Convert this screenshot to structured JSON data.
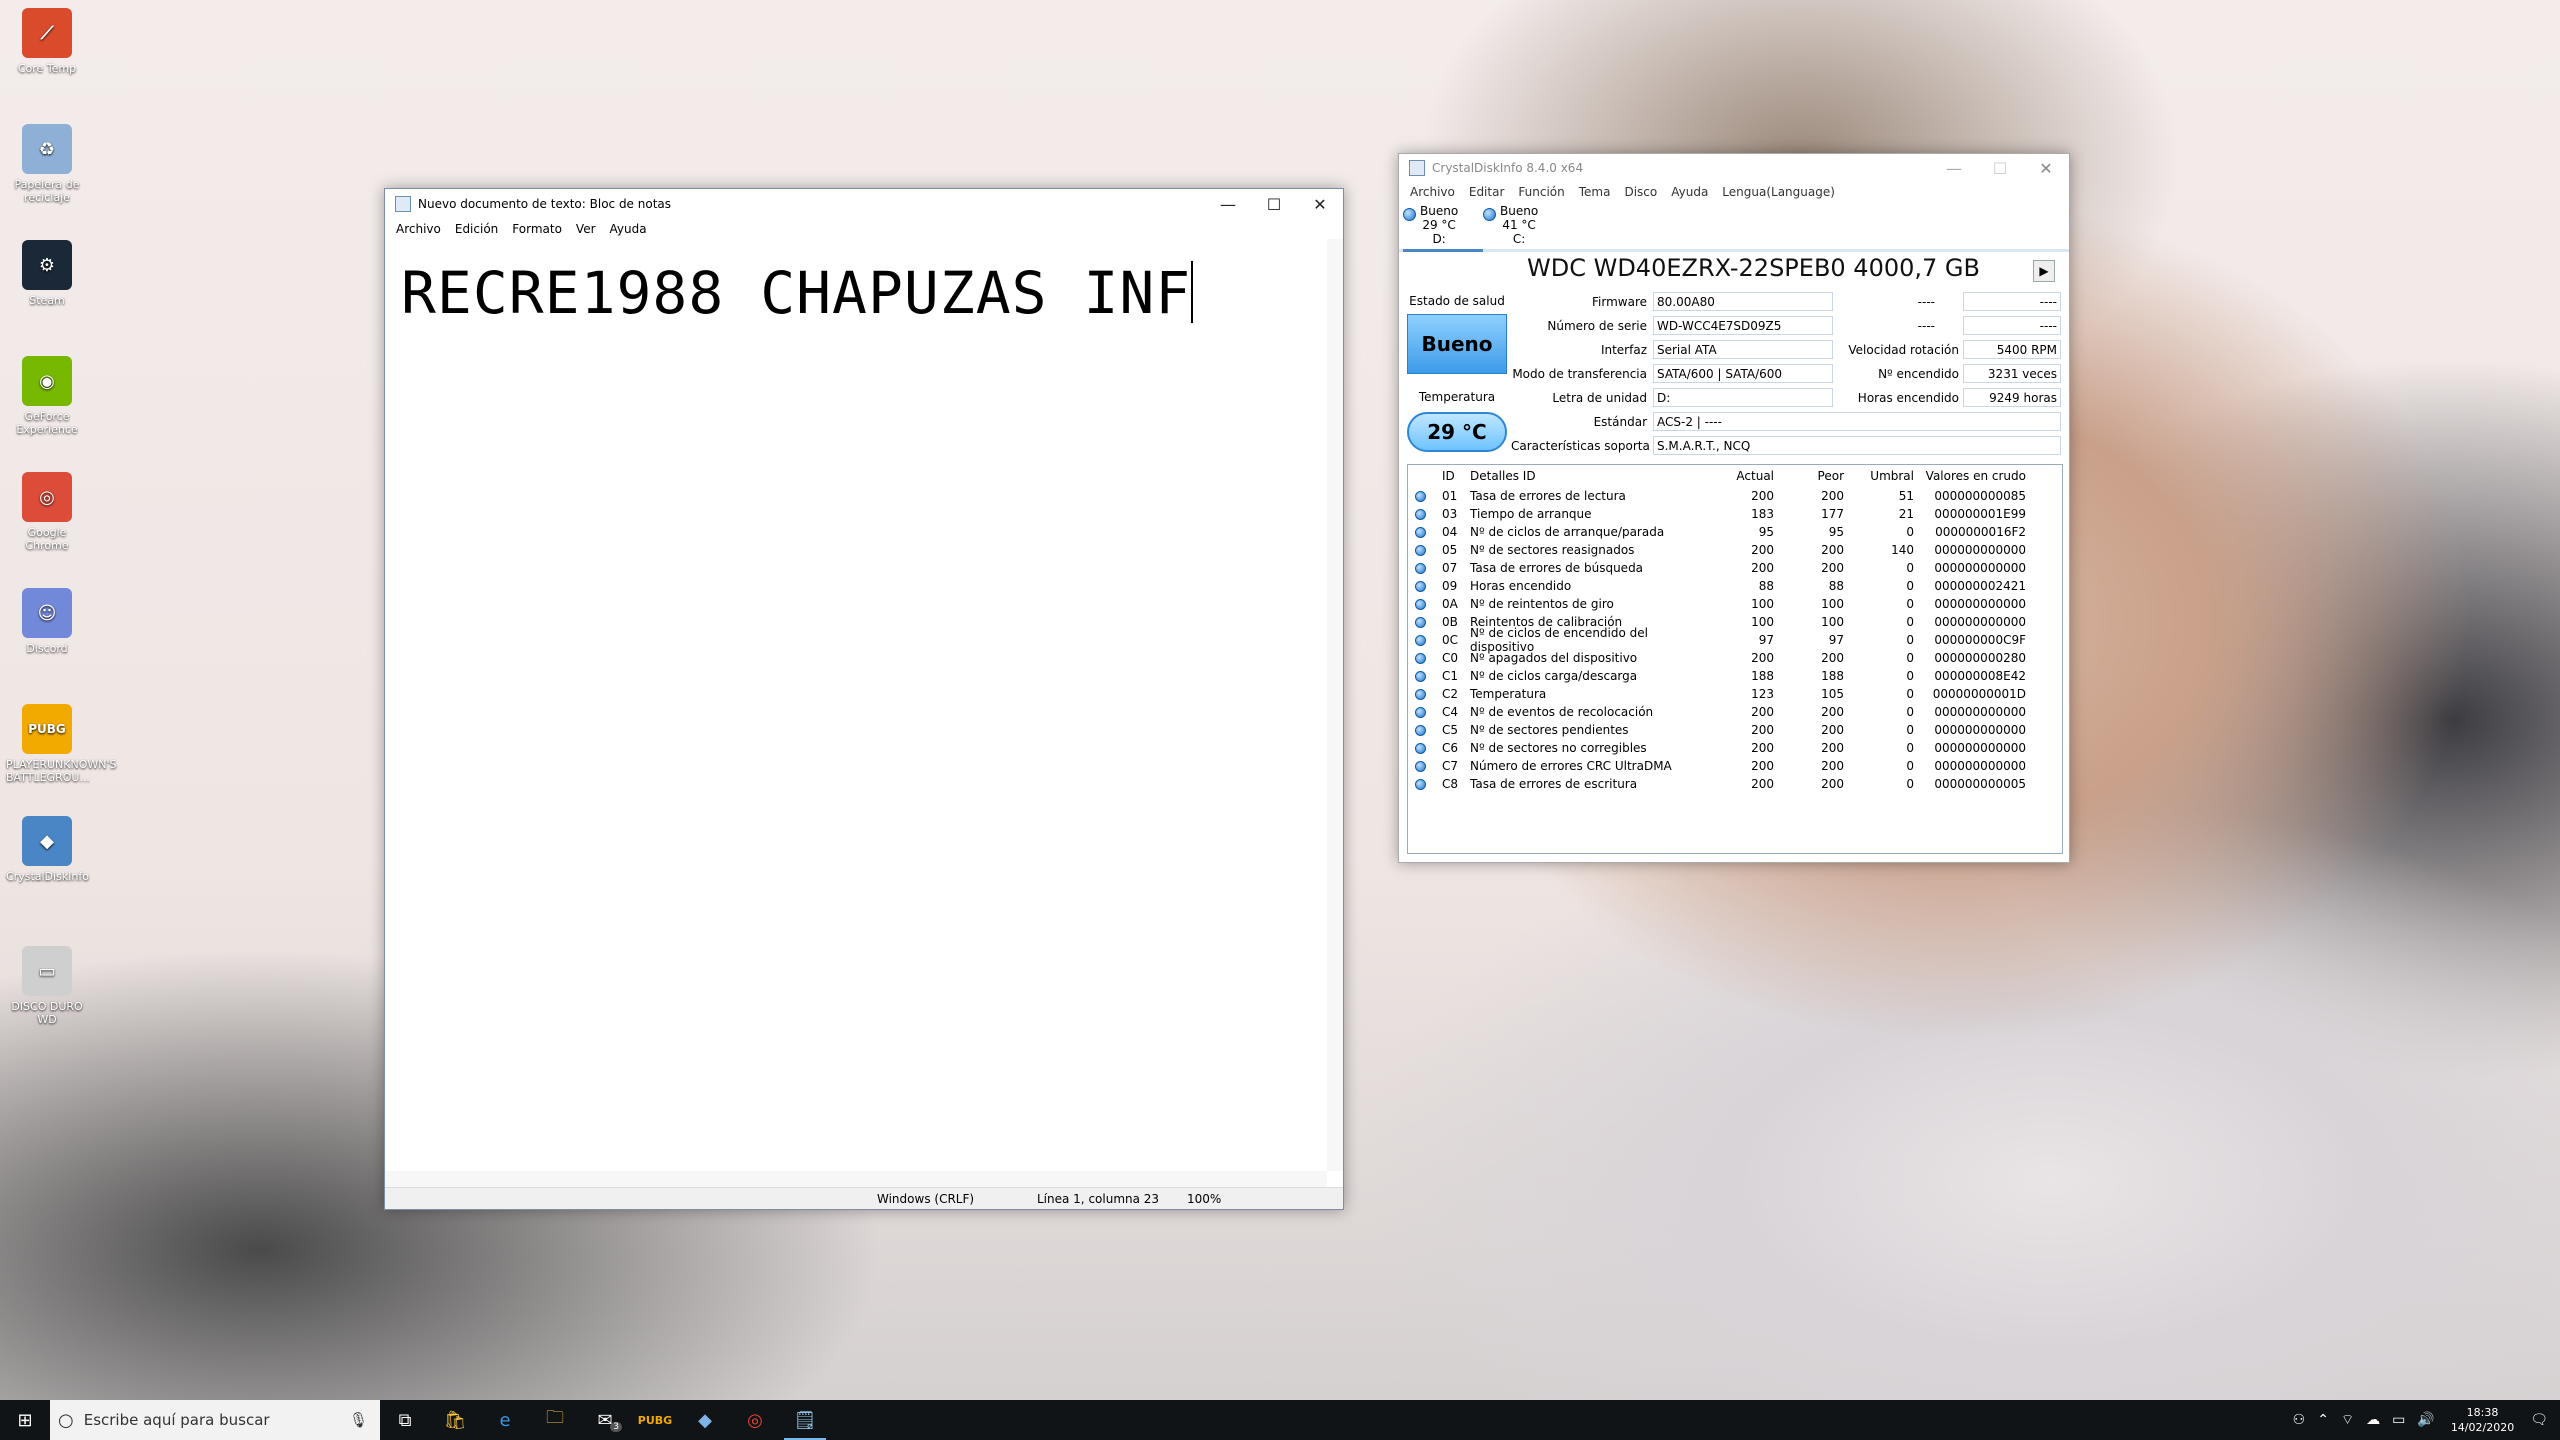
{
  "desktop": {
    "icons": [
      {
        "label": "Core Temp",
        "icon": "thermometer-app-icon",
        "glyph": "⟋",
        "color": "#d94b2b"
      },
      {
        "label": "Papelera de reciclaje",
        "icon": "recycle-bin-icon",
        "glyph": "♻",
        "color": "#8fb0d6"
      },
      {
        "label": "Steam",
        "icon": "steam-icon",
        "glyph": "⚙",
        "color": "#1b2838"
      },
      {
        "label": "GeForce Experience",
        "icon": "geforce-icon",
        "glyph": "◉",
        "color": "#76b900"
      },
      {
        "label": "Google Chrome",
        "icon": "chrome-icon",
        "glyph": "◎",
        "color": "#dd4b39"
      },
      {
        "label": "Discord",
        "icon": "discord-icon",
        "glyph": "☺",
        "color": "#7289da"
      },
      {
        "label": "PLAYERUNKNOWN'S BATTLEGROU...",
        "icon": "pubg-icon",
        "glyph": "PUBG",
        "color": "#f2a900"
      },
      {
        "label": "CrystalDiskInfo",
        "icon": "crystaldiskinfo-icon",
        "glyph": "◆",
        "color": "#4a86c5"
      },
      {
        "label": "DISCO DURO WD",
        "icon": "hard-drive-icon",
        "glyph": "▭",
        "color": "#cfcfcf"
      }
    ]
  },
  "notepad": {
    "title": "Nuevo documento de texto: Bloc de notas",
    "menu": [
      "Archivo",
      "Edición",
      "Formato",
      "Ver",
      "Ayuda"
    ],
    "content": "RECRE1988 CHAPUZAS INF",
    "status": {
      "encoding": "Windows (CRLF)",
      "position": "Línea 1, columna 23",
      "zoom": "100%"
    }
  },
  "cdi": {
    "title": "CrystalDiskInfo 8.4.0 x64",
    "menu": [
      "Archivo",
      "Editar",
      "Función",
      "Tema",
      "Disco",
      "Ayuda",
      "Lengua(Language)"
    ],
    "drives": [
      {
        "status": "Bueno",
        "temp": "29 °C",
        "letter": "D:"
      },
      {
        "status": "Bueno",
        "temp": "41 °C",
        "letter": "C:"
      }
    ],
    "model": "WDC WD40EZRX-22SPEB0 4000,7 GB",
    "health_label": "Estado de salud",
    "health": "Bueno",
    "temp_label": "Temperatura",
    "temp": "29 °C",
    "fields": {
      "firmware_label": "Firmware",
      "firmware": "80.00A80",
      "serial_label": "Número de serie",
      "serial": "WD-WCC4E7SD09Z5",
      "interface_label": "Interfaz",
      "interface": "Serial ATA",
      "transfer_label": "Modo de transferencia",
      "transfer": "SATA/600 | SATA/600",
      "letter_label": "Letra de unidad",
      "letter": "D:",
      "standard_label": "Estándar",
      "standard": "ACS-2 | ----",
      "features_label": "Características soporta",
      "features": "S.M.A.R.T., NCQ",
      "blank1_label": "----",
      "blank1": "----",
      "blank2_label": "----",
      "blank2": "----",
      "rotation_label": "Velocidad rotación",
      "rotation": "5400 RPM",
      "powercount_label": "Nº encendido",
      "powercount": "3231 veces",
      "powerhours_label": "Horas encendido",
      "powerhours": "9249 horas"
    },
    "smart_headers": [
      "ID",
      "Detalles ID",
      "Actual",
      "Peor",
      "Umbral",
      "Valores en crudo"
    ],
    "smart_rows": [
      [
        "01",
        "Tasa de errores de lectura",
        "200",
        "200",
        "51",
        "000000000085"
      ],
      [
        "03",
        "Tiempo de arranque",
        "183",
        "177",
        "21",
        "000000001E99"
      ],
      [
        "04",
        "Nº de ciclos de arranque/parada",
        "95",
        "95",
        "0",
        "0000000016F2"
      ],
      [
        "05",
        "Nº de sectores reasignados",
        "200",
        "200",
        "140",
        "000000000000"
      ],
      [
        "07",
        "Tasa de errores de búsqueda",
        "200",
        "200",
        "0",
        "000000000000"
      ],
      [
        "09",
        "Horas encendido",
        "88",
        "88",
        "0",
        "000000002421"
      ],
      [
        "0A",
        "Nº de reintentos de giro",
        "100",
        "100",
        "0",
        "000000000000"
      ],
      [
        "0B",
        "Reintentos de calibración",
        "100",
        "100",
        "0",
        "000000000000"
      ],
      [
        "0C",
        "Nº de ciclos de encendido del dispositivo",
        "97",
        "97",
        "0",
        "000000000C9F"
      ],
      [
        "C0",
        "Nº apagados del dispositivo",
        "200",
        "200",
        "0",
        "000000000280"
      ],
      [
        "C1",
        "Nº de ciclos carga/descarga",
        "188",
        "188",
        "0",
        "000000008E42"
      ],
      [
        "C2",
        "Temperatura",
        "123",
        "105",
        "0",
        "00000000001D"
      ],
      [
        "C4",
        "Nº de eventos de recolocación",
        "200",
        "200",
        "0",
        "000000000000"
      ],
      [
        "C5",
        "Nº de sectores pendientes",
        "200",
        "200",
        "0",
        "000000000000"
      ],
      [
        "C6",
        "Nº de sectores no corregibles",
        "200",
        "200",
        "0",
        "000000000000"
      ],
      [
        "C7",
        "Número de errores CRC UltraDMA",
        "200",
        "200",
        "0",
        "000000000000"
      ],
      [
        "C8",
        "Tasa de errores de escritura",
        "200",
        "200",
        "0",
        "000000000005"
      ]
    ]
  },
  "taskbar": {
    "search_placeholder": "Escribe aquí para buscar",
    "time": "18:38",
    "date": "14/02/2020",
    "mail_badge": "3"
  }
}
